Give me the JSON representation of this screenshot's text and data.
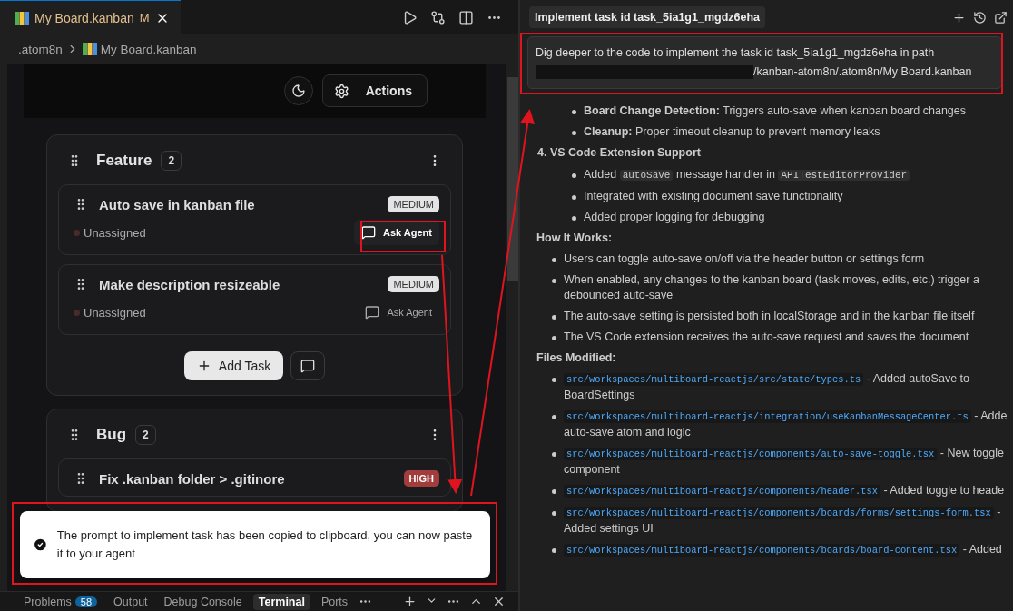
{
  "editor": {
    "tab": {
      "title": "My Board.kanban",
      "status": "M",
      "selected": true
    },
    "breadcrumb": [
      ".atom8n",
      "My Board.kanban"
    ],
    "header": {
      "actions_label": "Actions"
    },
    "columns": [
      {
        "title": "Feature",
        "count": "2",
        "add_label": "Add Task",
        "tasks": [
          {
            "title": "Auto save in kanban file",
            "priority": "MEDIUM",
            "color": "#e4e4e4",
            "assignee": "Unassigned",
            "ask_label": "Ask Agent",
            "highlighted": true
          },
          {
            "title": "Make description resizeable",
            "priority": "MEDIUM",
            "color": "#e4e4e4",
            "assignee": "Unassigned",
            "ask_label": "Ask Agent",
            "highlighted": false
          }
        ]
      },
      {
        "title": "Bug",
        "count": "2",
        "tasks": [
          {
            "title": "Fix .kanban folder > .gitinore",
            "priority": "HIGH",
            "color": "#a23d3d"
          }
        ]
      }
    ]
  },
  "toast": {
    "kind": "success",
    "message": "The prompt to implement task has been copied to clipboard, you can now paste it to your agent"
  },
  "panel_tabs": [
    {
      "label": "Problems",
      "badge": "58",
      "selected": false
    },
    {
      "label": "Output",
      "selected": false
    },
    {
      "label": "Debug Console",
      "selected": false
    },
    {
      "label": "Terminal",
      "selected": true
    },
    {
      "label": "Ports",
      "selected": false
    }
  ],
  "chat": {
    "title": "Implement task id task_5ia1g1_mgdz6eha",
    "prompt": {
      "before": "Dig deeper to the code to implement the task id task_5ia1g1_mgdz6eha in path",
      "redacted": true,
      "after": "/kanban-atom8n/.atom8n/My Board.kanban"
    },
    "blocks": [
      {
        "kind": "numbered",
        "items": [
          {
            "children": [
              {
                "segments": [
                  {
                    "kind": "bold",
                    "text": "Board Change Detection:"
                  },
                  {
                    "kind": "text",
                    "text": " Triggers auto-save when kanban board changes"
                  }
                ]
              },
              {
                "segments": [
                  {
                    "kind": "bold",
                    "text": "Cleanup:"
                  },
                  {
                    "kind": "text",
                    "text": " Proper timeout cleanup to prevent memory leaks"
                  }
                ]
              }
            ]
          },
          {
            "number": "4.",
            "text": "VS Code Extension Support",
            "children": [
              {
                "segments": [
                  {
                    "kind": "text",
                    "text": "Added "
                  },
                  {
                    "kind": "code",
                    "text": "autoSave"
                  },
                  {
                    "kind": "text",
                    "text": " message handler in "
                  },
                  {
                    "kind": "code",
                    "text": "APITestEditorProvider"
                  }
                ]
              },
              {
                "segments": [
                  {
                    "kind": "text",
                    "text": "Integrated with existing document save functionality"
                  }
                ]
              },
              {
                "segments": [
                  {
                    "kind": "text",
                    "text": "Added proper logging for debugging"
                  }
                ]
              }
            ]
          }
        ]
      },
      {
        "kind": "heading",
        "text": "How It Works:"
      },
      {
        "kind": "bullets",
        "items": [
          {
            "segments": [
              {
                "kind": "text",
                "text": "Users can toggle auto-save on/off via the header button or settings form"
              }
            ]
          },
          {
            "segments": [
              {
                "kind": "text",
                "text": "When enabled, any changes to the kanban board (task moves, edits, etc.) trigger a debounced auto-save"
              }
            ]
          },
          {
            "segments": [
              {
                "kind": "text",
                "text": "The auto-save setting is persisted both in localStorage and in the kanban file itself"
              }
            ]
          },
          {
            "segments": [
              {
                "kind": "text",
                "text": "The VS Code extension receives the auto-save request and saves the document"
              }
            ]
          }
        ]
      },
      {
        "kind": "heading",
        "text": "Files Modified:"
      },
      {
        "kind": "bullets",
        "items": [
          {
            "segments": [
              {
                "kind": "path",
                "text": "src/workspaces/multiboard-reactjs/src/state/types.ts"
              },
              {
                "kind": "text",
                "text": " - Added autoSave to BoardSettings"
              }
            ]
          },
          {
            "segments": [
              {
                "kind": "path",
                "text": "src/workspaces/multiboard-reactjs/integration/useKanbanMessageCenter.ts"
              },
              {
                "kind": "text",
                "text": " - Adde auto-save atom and logic"
              }
            ]
          },
          {
            "segments": [
              {
                "kind": "path",
                "text": "src/workspaces/multiboard-reactjs/components/auto-save-toggle.tsx"
              },
              {
                "kind": "text",
                "text": " - New toggle component"
              }
            ]
          },
          {
            "segments": [
              {
                "kind": "path",
                "text": "src/workspaces/multiboard-reactjs/components/header.tsx"
              },
              {
                "kind": "text",
                "text": " - Added toggle to heade"
              }
            ]
          },
          {
            "segments": [
              {
                "kind": "path",
                "text": "src/workspaces/multiboard-reactjs/components/boards/forms/settings-form.tsx"
              },
              {
                "kind": "text",
                "text": " - Added settings UI"
              }
            ]
          },
          {
            "segments": [
              {
                "kind": "path",
                "text": "src/workspaces/multiboard-reactjs/components/boards/board-content.tsx"
              },
              {
                "kind": "text",
                "text": " - Added"
              }
            ]
          }
        ]
      }
    ]
  }
}
